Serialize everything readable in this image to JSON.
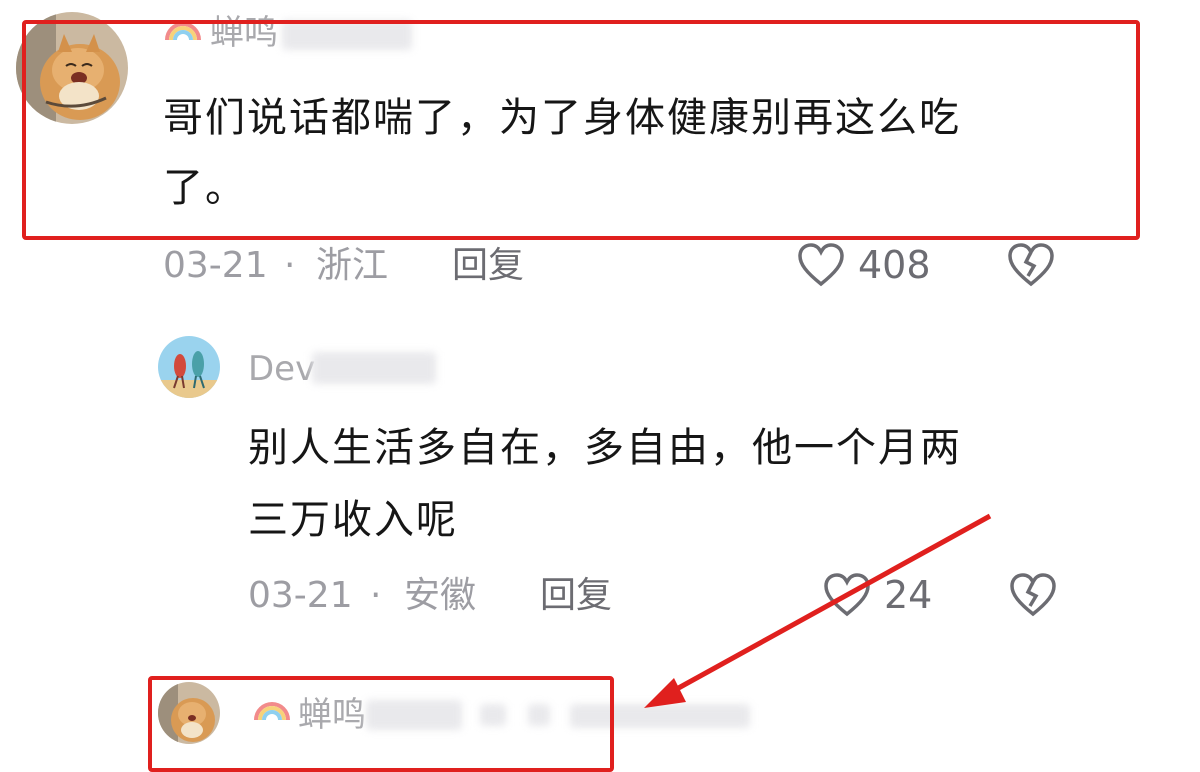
{
  "comments": [
    {
      "username": "蝉鸣",
      "username_redacted": true,
      "avatar_icon": "cat-avatar",
      "badge_icon": "rainbow-icon",
      "content_lines": [
        "哥们说话都喘了，为了身体健康别再这么吃",
        "了。"
      ],
      "date": "03-21",
      "separator": "·",
      "location": "浙江",
      "reply_label": "回复",
      "like_count": "408",
      "highlighted": true
    },
    {
      "username": "Dev",
      "username_redacted": true,
      "avatar_icon": "cartoon-characters-avatar",
      "content_lines": [
        "别人生活多自在，多自由，他一个月两",
        "三万收入呢"
      ],
      "date": "03-21",
      "separator": "·",
      "location": "安徽",
      "reply_label": "回复",
      "like_count": "24",
      "highlighted": false
    },
    {
      "username": "蝉鸣",
      "username_redacted": true,
      "avatar_icon": "cat-avatar",
      "badge_icon": "rainbow-icon",
      "highlighted": true
    }
  ],
  "colors": {
    "highlight": "#e0201e",
    "text": "#161616",
    "meta": "#9d9da3",
    "username": "#a9a9ad"
  },
  "icons": {
    "like": "heart-outline-icon",
    "dislike": "broken-heart-icon",
    "annotation": "red-arrow"
  }
}
